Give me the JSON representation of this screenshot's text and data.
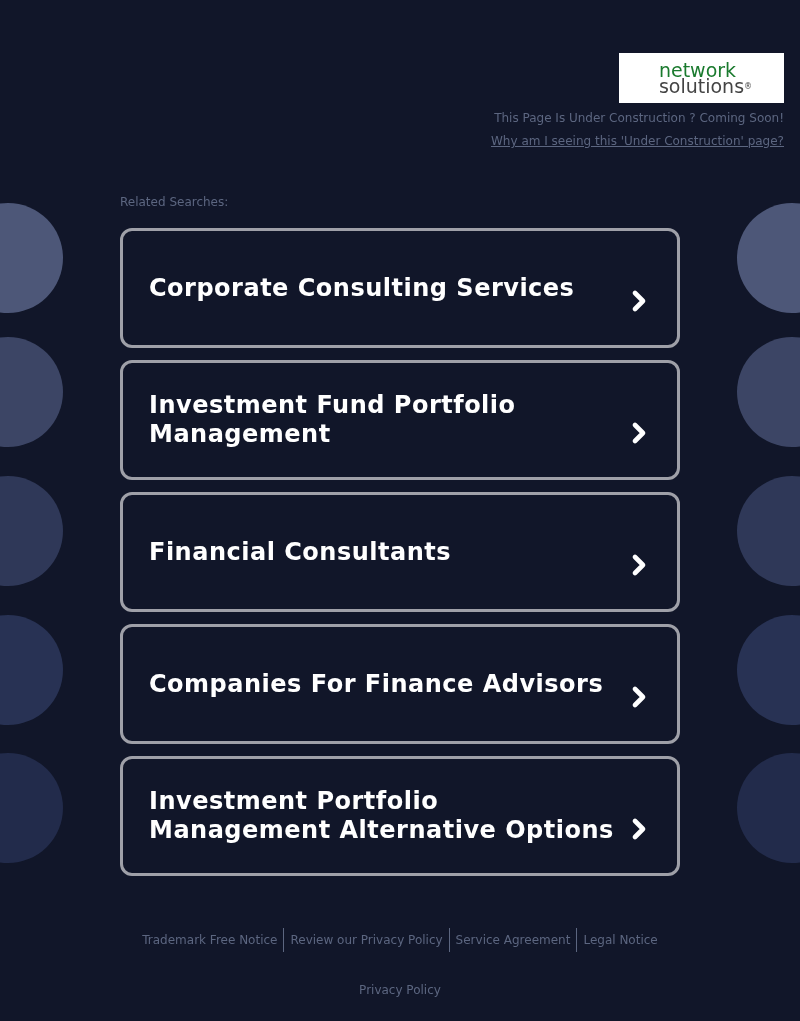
{
  "logo": {
    "line_1": "network",
    "line_2": "solutions",
    "mark": "®"
  },
  "notice": "This Page Is Under Construction ? Coming Soon!",
  "why_link": "Why am I seeing this 'Under Construction' page?",
  "related_label": "Related Searches:",
  "searches": [
    {
      "label": "Corporate Consulting Services"
    },
    {
      "label": "Investment Fund Portfolio Management"
    },
    {
      "label": "Financial Consultants"
    },
    {
      "label": "Companies For Finance Advisors"
    },
    {
      "label": "Investment Portfolio Management Alternative Options"
    }
  ],
  "footer_links": [
    "Trademark Free Notice",
    "Review our Privacy Policy",
    "Service Agreement",
    "Legal Notice"
  ],
  "privacy_link": "Privacy Policy"
}
